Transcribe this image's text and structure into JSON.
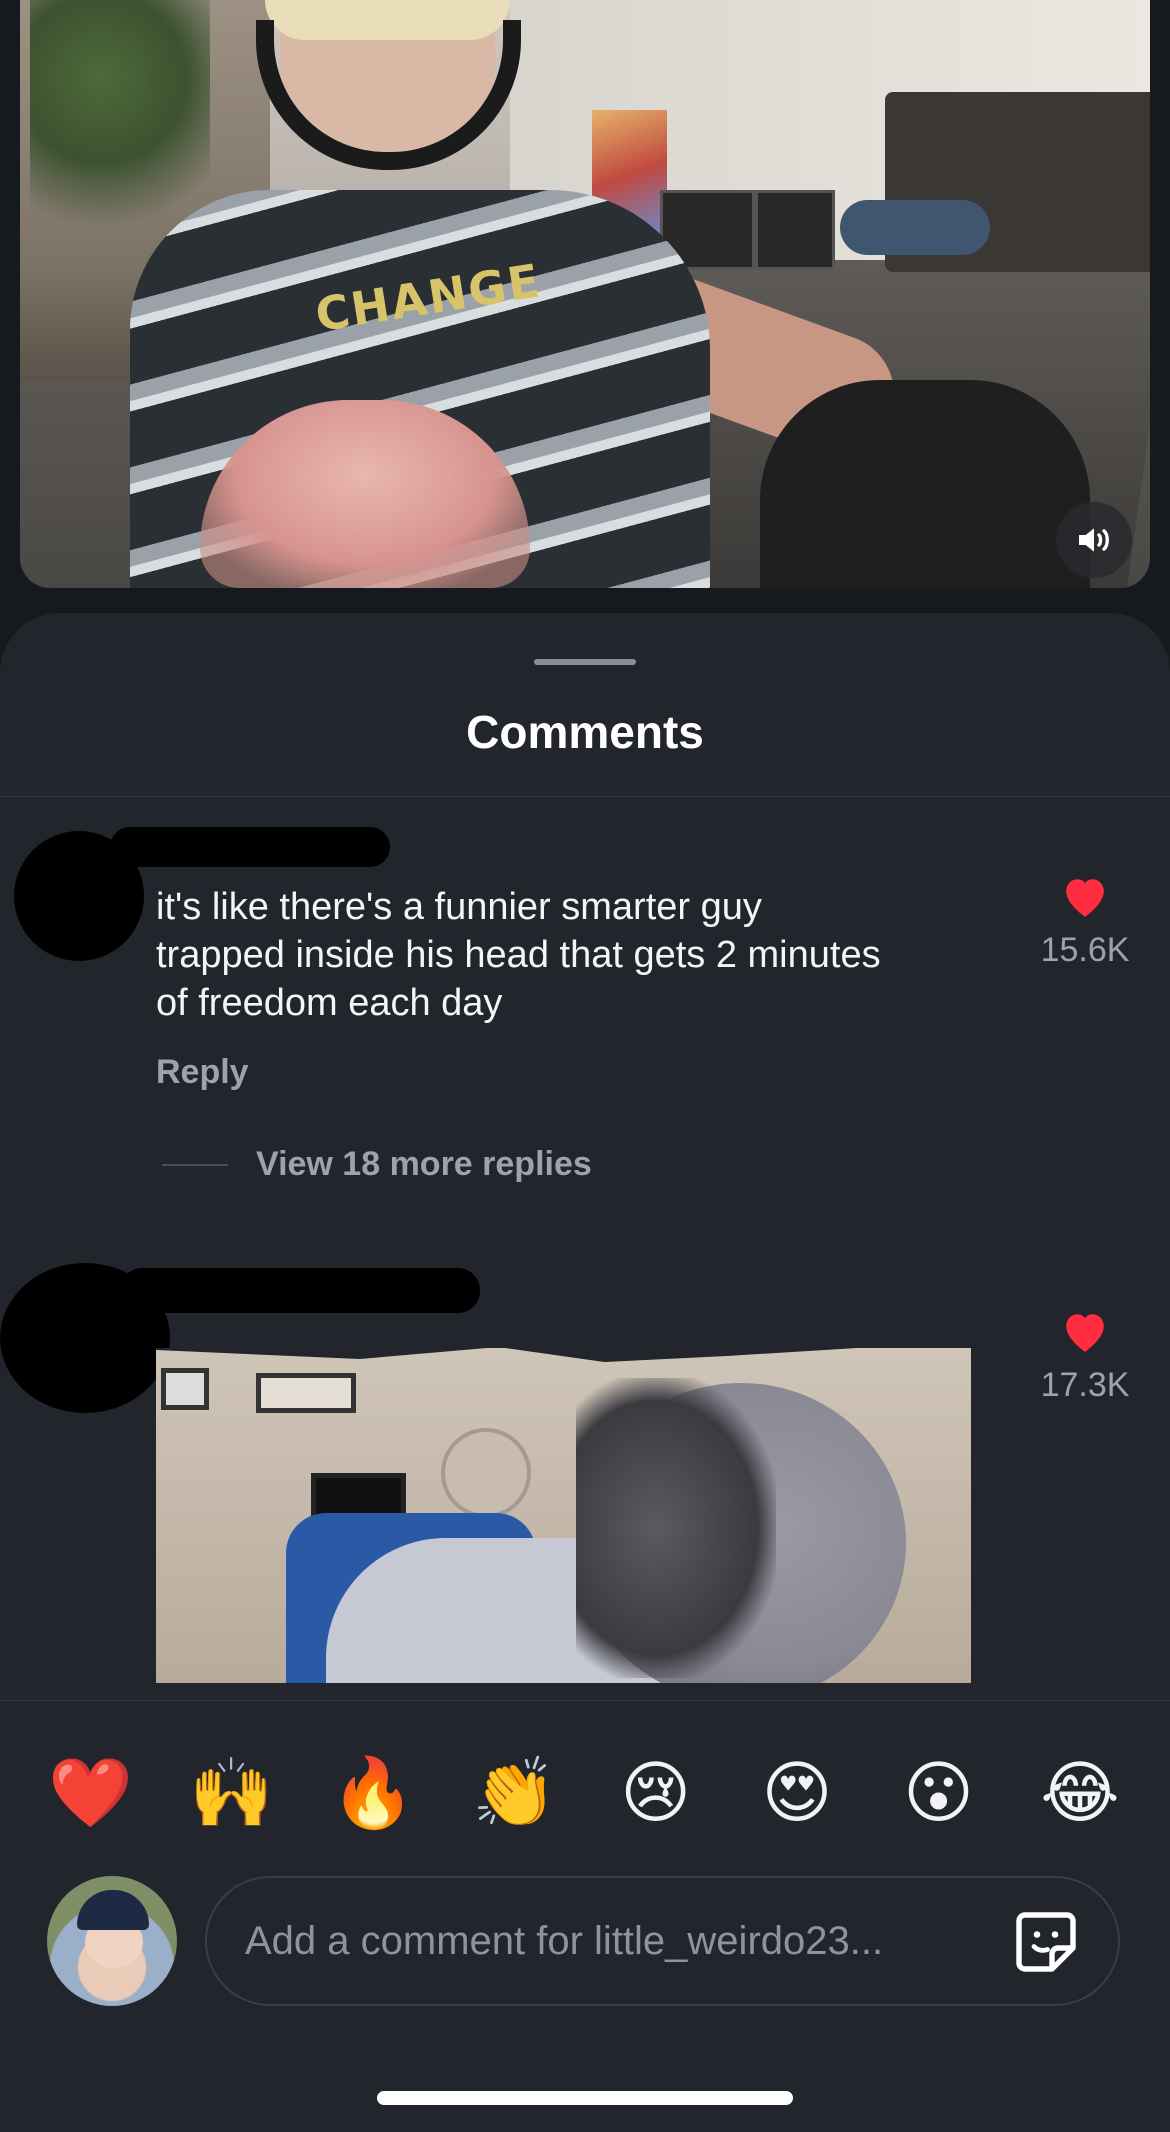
{
  "video": {
    "shirt_logo": "CHANGE",
    "mute_icon": "speaker-icon"
  },
  "sheet": {
    "title": "Comments"
  },
  "comments": [
    {
      "text_lines": [
        "it's like there's a funnier smarter guy",
        "trapped inside his head that gets 2 minutes",
        "of freedom each day"
      ],
      "likes": "15.6K",
      "reply_label": "Reply",
      "view_replies": "View 18 more replies",
      "like_icon": "heart-icon",
      "like_color": "#ff2d3f"
    },
    {
      "media": "gif",
      "likes": "17.3K",
      "like_icon": "heart-icon",
      "like_color": "#ff2d3f"
    }
  ],
  "reactions": [
    "❤️",
    "🙌",
    "🔥",
    "👏",
    "😢",
    "😍",
    "😮",
    "😂"
  ],
  "composer": {
    "placeholder": "Add a comment for little_weirdo23...",
    "sticker_icon": "sticker-icon"
  },
  "colors": {
    "background": "#161a1f",
    "sheet": "#22252b",
    "accent_like": "#ff2d3f",
    "secondary_text": "#9da2ab"
  }
}
